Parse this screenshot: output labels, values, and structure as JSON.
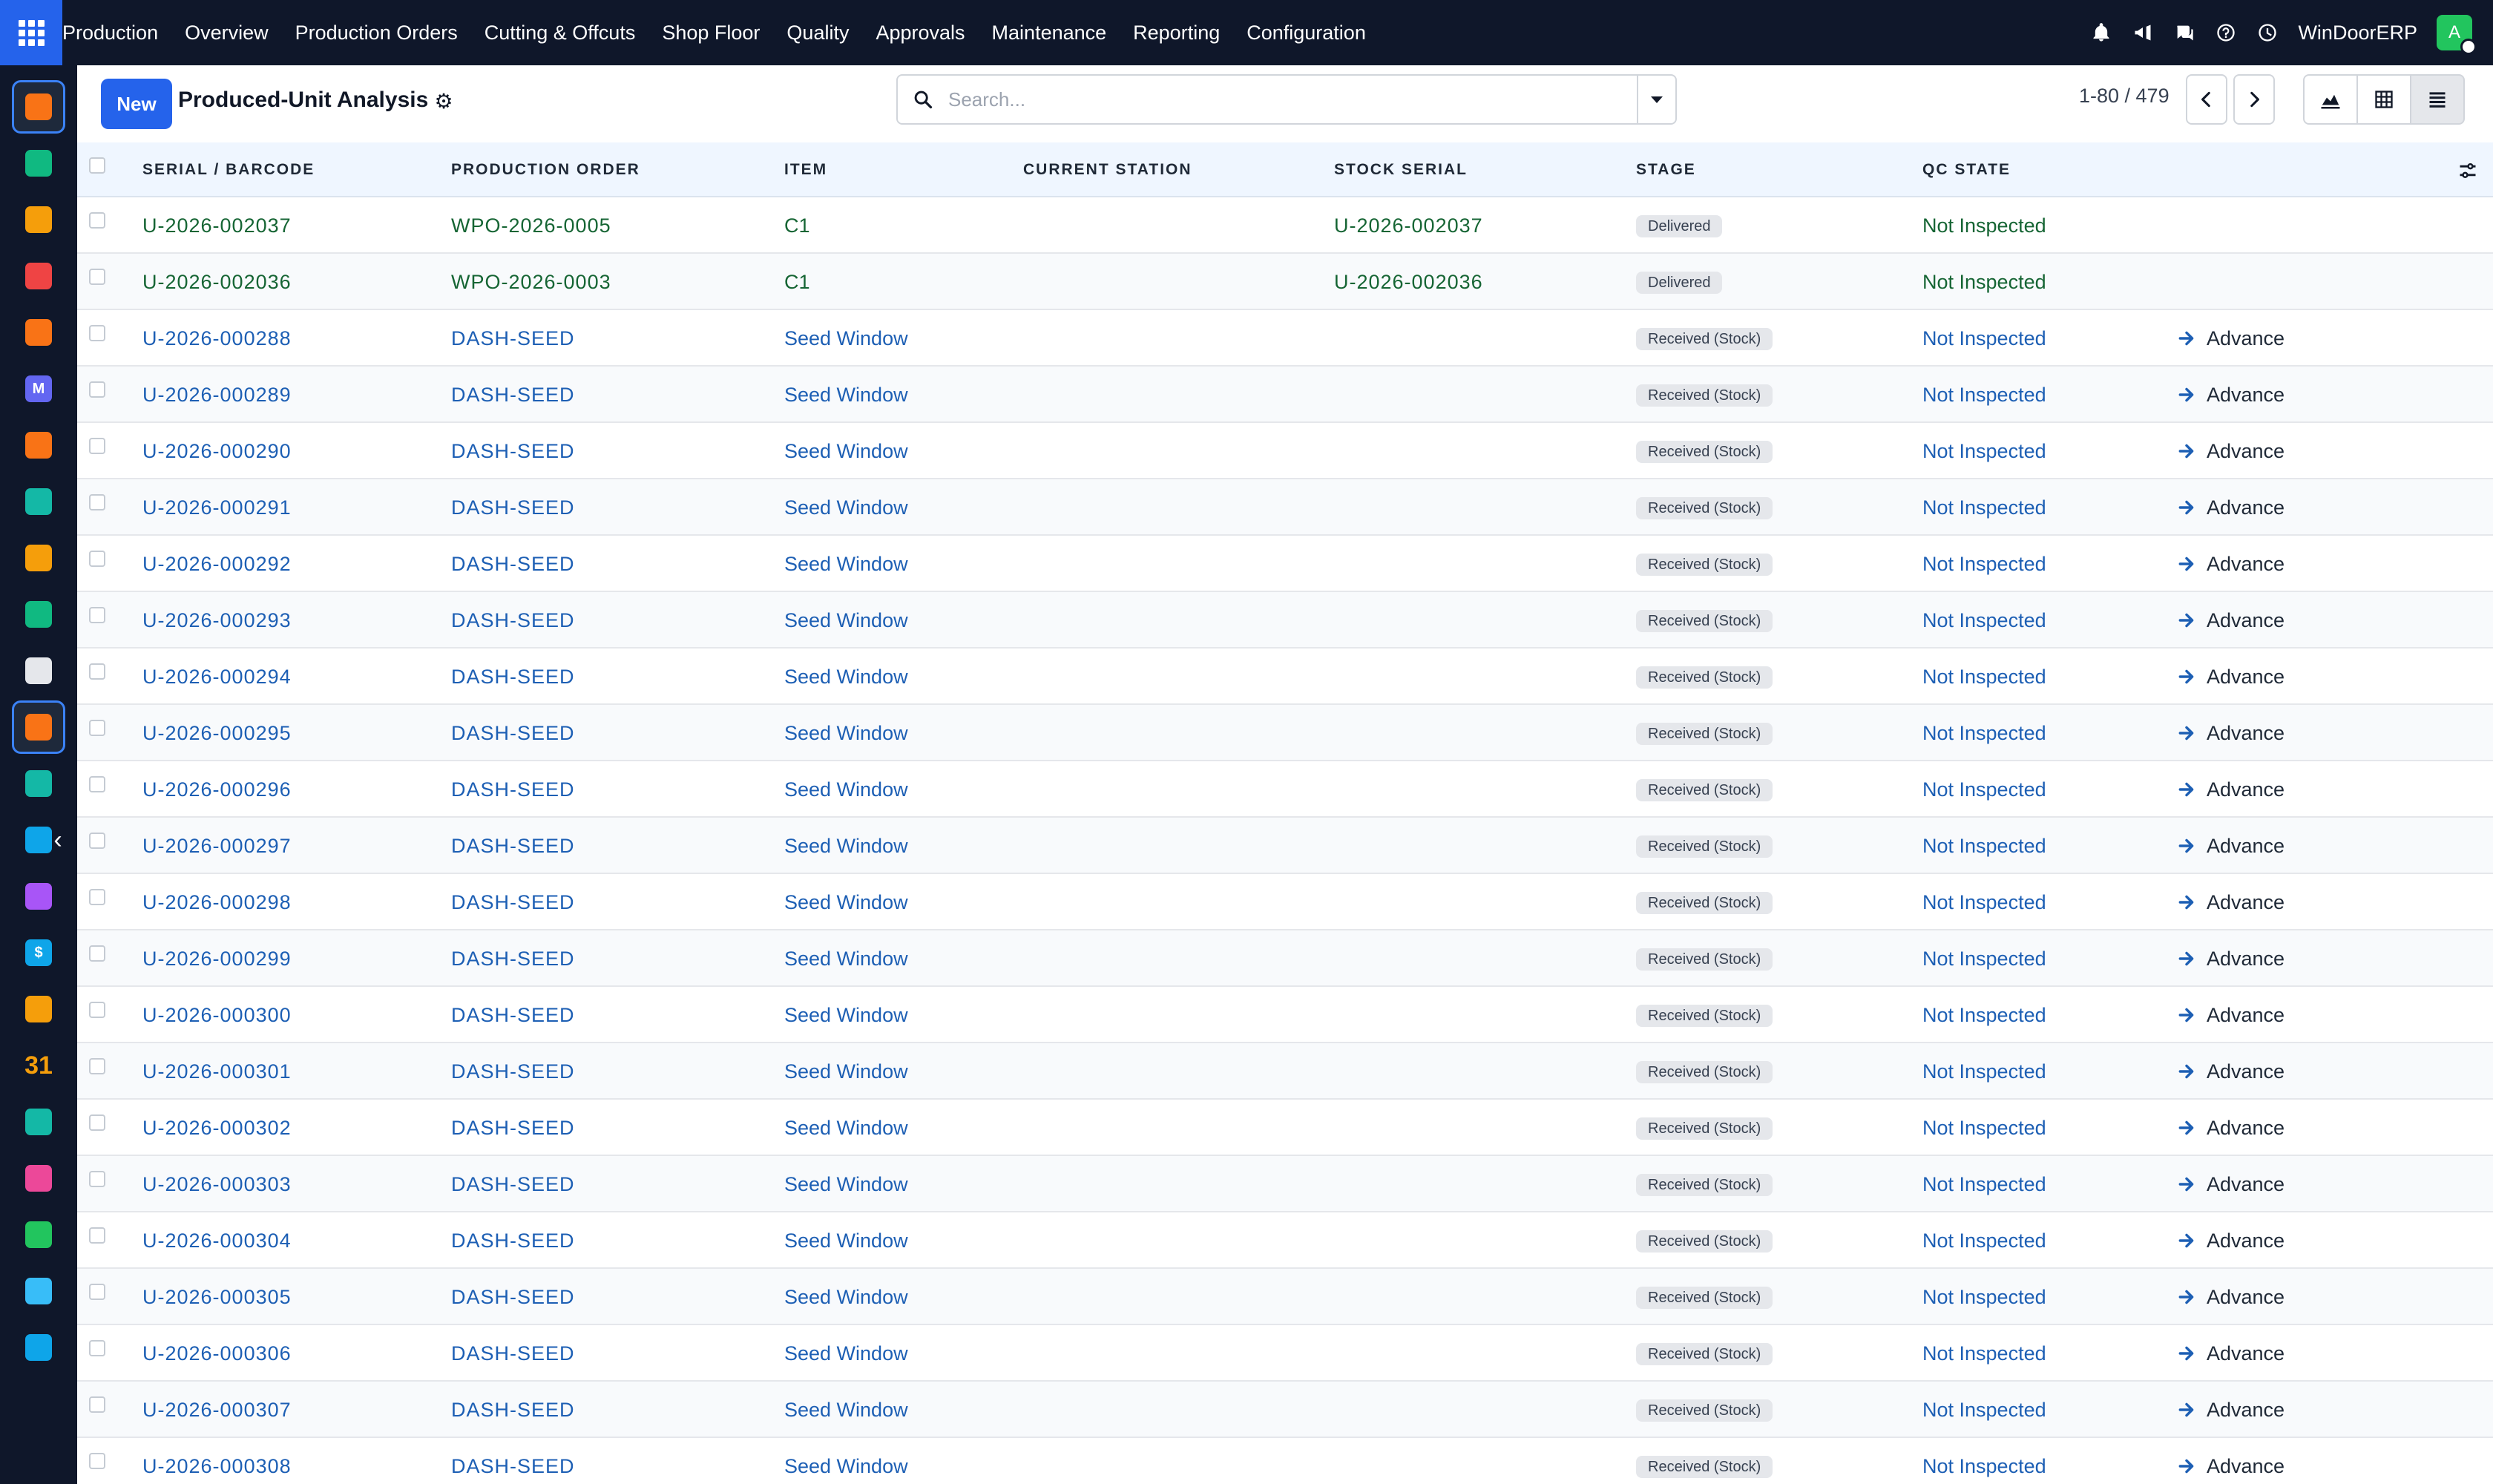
{
  "navbar": {
    "brand": "Production",
    "menu": [
      "Overview",
      "Production Orders",
      "Cutting & Offcuts",
      "Shop Floor",
      "Quality",
      "Approvals",
      "Maintenance",
      "Reporting",
      "Configuration"
    ],
    "company": "WinDoorERP",
    "avatar_initial": "A",
    "icons": [
      "bell-icon",
      "megaphone-icon",
      "chat-icon",
      "help-icon",
      "clock-icon"
    ]
  },
  "sidebar": {
    "apps": [
      {
        "icon": "production-app-icon",
        "color": "#f97316",
        "glyph": ""
      },
      {
        "icon": "contacts-app-icon",
        "color": "#10b981",
        "glyph": ""
      },
      {
        "icon": "reporting-app-icon",
        "color": "#f59e0b",
        "glyph": ""
      },
      {
        "icon": "dashboard-app-icon",
        "color": "#ef4444",
        "glyph": ""
      },
      {
        "icon": "discuss-app-icon",
        "color": "#f97316",
        "glyph": ""
      },
      {
        "icon": "mail-app-icon",
        "color": "#6366f1",
        "glyph": "M"
      },
      {
        "icon": "chat-app-icon",
        "color": "#f97316",
        "glyph": ""
      },
      {
        "icon": "check-app-icon",
        "color": "#14b8a6",
        "glyph": ""
      },
      {
        "icon": "chart-app-icon",
        "color": "#f59e0b",
        "glyph": ""
      },
      {
        "icon": "employees-app-icon",
        "color": "#10b981",
        "glyph": ""
      },
      {
        "icon": "inventory-app-icon",
        "color": "#e5e7eb",
        "glyph": ""
      },
      {
        "icon": "production-app-icon-active",
        "color": "#f97316",
        "glyph": ""
      },
      {
        "icon": "tasks-app-icon",
        "color": "#14b8a6",
        "glyph": ""
      },
      {
        "icon": "knowledge-app-icon",
        "color": "#0ea5e9",
        "glyph": ""
      },
      {
        "icon": "quality-app-icon",
        "color": "#a855f7",
        "glyph": ""
      },
      {
        "icon": "invoicing-app-icon",
        "color": "#0ea5e9",
        "glyph": "$"
      },
      {
        "icon": "team-app-icon",
        "color": "#f59e0b",
        "glyph": ""
      },
      {
        "icon": "calendar-app-icon",
        "color": "#f59e0b",
        "glyph": "31"
      },
      {
        "icon": "sign-app-icon",
        "color": "#14b8a6",
        "glyph": ""
      },
      {
        "icon": "apps-app-icon",
        "color": "#ec4899",
        "glyph": ""
      },
      {
        "icon": "whatsapp-app-icon",
        "color": "#22c55e",
        "glyph": ""
      },
      {
        "icon": "time-app-icon",
        "color": "#38bdf8",
        "glyph": ""
      },
      {
        "icon": "waves-app-icon",
        "color": "#0ea5e9",
        "glyph": ""
      }
    ]
  },
  "control": {
    "new_label": "New",
    "title": "Produced-Unit Analysis",
    "search_placeholder": "Search...",
    "pager": "1-80 / 479"
  },
  "table": {
    "columns": [
      "SERIAL / BARCODE",
      "PRODUCTION ORDER",
      "ITEM",
      "CURRENT STATION",
      "STOCK SERIAL",
      "STAGE",
      "QC STATE"
    ],
    "rows": [
      {
        "serial": "U-2026-002037",
        "order": "WPO-2026-0005",
        "item": "C1",
        "station": "",
        "stock_serial": "U-2026-002037",
        "stage": "Delivered",
        "qc": "Not Inspected",
        "action": "",
        "done": true
      },
      {
        "serial": "U-2026-002036",
        "order": "WPO-2026-0003",
        "item": "C1",
        "station": "",
        "stock_serial": "U-2026-002036",
        "stage": "Delivered",
        "qc": "Not Inspected",
        "action": "",
        "done": true
      },
      {
        "serial": "U-2026-000288",
        "order": "DASH-SEED",
        "item": "Seed Window",
        "station": "",
        "stock_serial": "",
        "stage": "Received (Stock)",
        "qc": "Not Inspected",
        "action": "Advance",
        "done": false
      },
      {
        "serial": "U-2026-000289",
        "order": "DASH-SEED",
        "item": "Seed Window",
        "station": "",
        "stock_serial": "",
        "stage": "Received (Stock)",
        "qc": "Not Inspected",
        "action": "Advance",
        "done": false
      },
      {
        "serial": "U-2026-000290",
        "order": "DASH-SEED",
        "item": "Seed Window",
        "station": "",
        "stock_serial": "",
        "stage": "Received (Stock)",
        "qc": "Not Inspected",
        "action": "Advance",
        "done": false
      },
      {
        "serial": "U-2026-000291",
        "order": "DASH-SEED",
        "item": "Seed Window",
        "station": "",
        "stock_serial": "",
        "stage": "Received (Stock)",
        "qc": "Not Inspected",
        "action": "Advance",
        "done": false
      },
      {
        "serial": "U-2026-000292",
        "order": "DASH-SEED",
        "item": "Seed Window",
        "station": "",
        "stock_serial": "",
        "stage": "Received (Stock)",
        "qc": "Not Inspected",
        "action": "Advance",
        "done": false
      },
      {
        "serial": "U-2026-000293",
        "order": "DASH-SEED",
        "item": "Seed Window",
        "station": "",
        "stock_serial": "",
        "stage": "Received (Stock)",
        "qc": "Not Inspected",
        "action": "Advance",
        "done": false
      },
      {
        "serial": "U-2026-000294",
        "order": "DASH-SEED",
        "item": "Seed Window",
        "station": "",
        "stock_serial": "",
        "stage": "Received (Stock)",
        "qc": "Not Inspected",
        "action": "Advance",
        "done": false
      },
      {
        "serial": "U-2026-000295",
        "order": "DASH-SEED",
        "item": "Seed Window",
        "station": "",
        "stock_serial": "",
        "stage": "Received (Stock)",
        "qc": "Not Inspected",
        "action": "Advance",
        "done": false
      },
      {
        "serial": "U-2026-000296",
        "order": "DASH-SEED",
        "item": "Seed Window",
        "station": "",
        "stock_serial": "",
        "stage": "Received (Stock)",
        "qc": "Not Inspected",
        "action": "Advance",
        "done": false
      },
      {
        "serial": "U-2026-000297",
        "order": "DASH-SEED",
        "item": "Seed Window",
        "station": "",
        "stock_serial": "",
        "stage": "Received (Stock)",
        "qc": "Not Inspected",
        "action": "Advance",
        "done": false
      },
      {
        "serial": "U-2026-000298",
        "order": "DASH-SEED",
        "item": "Seed Window",
        "station": "",
        "stock_serial": "",
        "stage": "Received (Stock)",
        "qc": "Not Inspected",
        "action": "Advance",
        "done": false
      },
      {
        "serial": "U-2026-000299",
        "order": "DASH-SEED",
        "item": "Seed Window",
        "station": "",
        "stock_serial": "",
        "stage": "Received (Stock)",
        "qc": "Not Inspected",
        "action": "Advance",
        "done": false
      },
      {
        "serial": "U-2026-000300",
        "order": "DASH-SEED",
        "item": "Seed Window",
        "station": "",
        "stock_serial": "",
        "stage": "Received (Stock)",
        "qc": "Not Inspected",
        "action": "Advance",
        "done": false
      },
      {
        "serial": "U-2026-000301",
        "order": "DASH-SEED",
        "item": "Seed Window",
        "station": "",
        "stock_serial": "",
        "stage": "Received (Stock)",
        "qc": "Not Inspected",
        "action": "Advance",
        "done": false
      },
      {
        "serial": "U-2026-000302",
        "order": "DASH-SEED",
        "item": "Seed Window",
        "station": "",
        "stock_serial": "",
        "stage": "Received (Stock)",
        "qc": "Not Inspected",
        "action": "Advance",
        "done": false
      },
      {
        "serial": "U-2026-000303",
        "order": "DASH-SEED",
        "item": "Seed Window",
        "station": "",
        "stock_serial": "",
        "stage": "Received (Stock)",
        "qc": "Not Inspected",
        "action": "Advance",
        "done": false
      },
      {
        "serial": "U-2026-000304",
        "order": "DASH-SEED",
        "item": "Seed Window",
        "station": "",
        "stock_serial": "",
        "stage": "Received (Stock)",
        "qc": "Not Inspected",
        "action": "Advance",
        "done": false
      },
      {
        "serial": "U-2026-000305",
        "order": "DASH-SEED",
        "item": "Seed Window",
        "station": "",
        "stock_serial": "",
        "stage": "Received (Stock)",
        "qc": "Not Inspected",
        "action": "Advance",
        "done": false
      },
      {
        "serial": "U-2026-000306",
        "order": "DASH-SEED",
        "item": "Seed Window",
        "station": "",
        "stock_serial": "",
        "stage": "Received (Stock)",
        "qc": "Not Inspected",
        "action": "Advance",
        "done": false
      },
      {
        "serial": "U-2026-000307",
        "order": "DASH-SEED",
        "item": "Seed Window",
        "station": "",
        "stock_serial": "",
        "stage": "Received (Stock)",
        "qc": "Not Inspected",
        "action": "Advance",
        "done": false
      },
      {
        "serial": "U-2026-000308",
        "order": "DASH-SEED",
        "item": "Seed Window",
        "station": "",
        "stock_serial": "",
        "stage": "Received (Stock)",
        "qc": "Not Inspected",
        "action": "Advance",
        "done": false
      }
    ]
  },
  "colors": {
    "navbar_bg": "#0f172a",
    "primary": "#2563eb",
    "link_green": "#166534",
    "link_blue": "#1d5fb4",
    "header_bg": "#eff6ff"
  }
}
